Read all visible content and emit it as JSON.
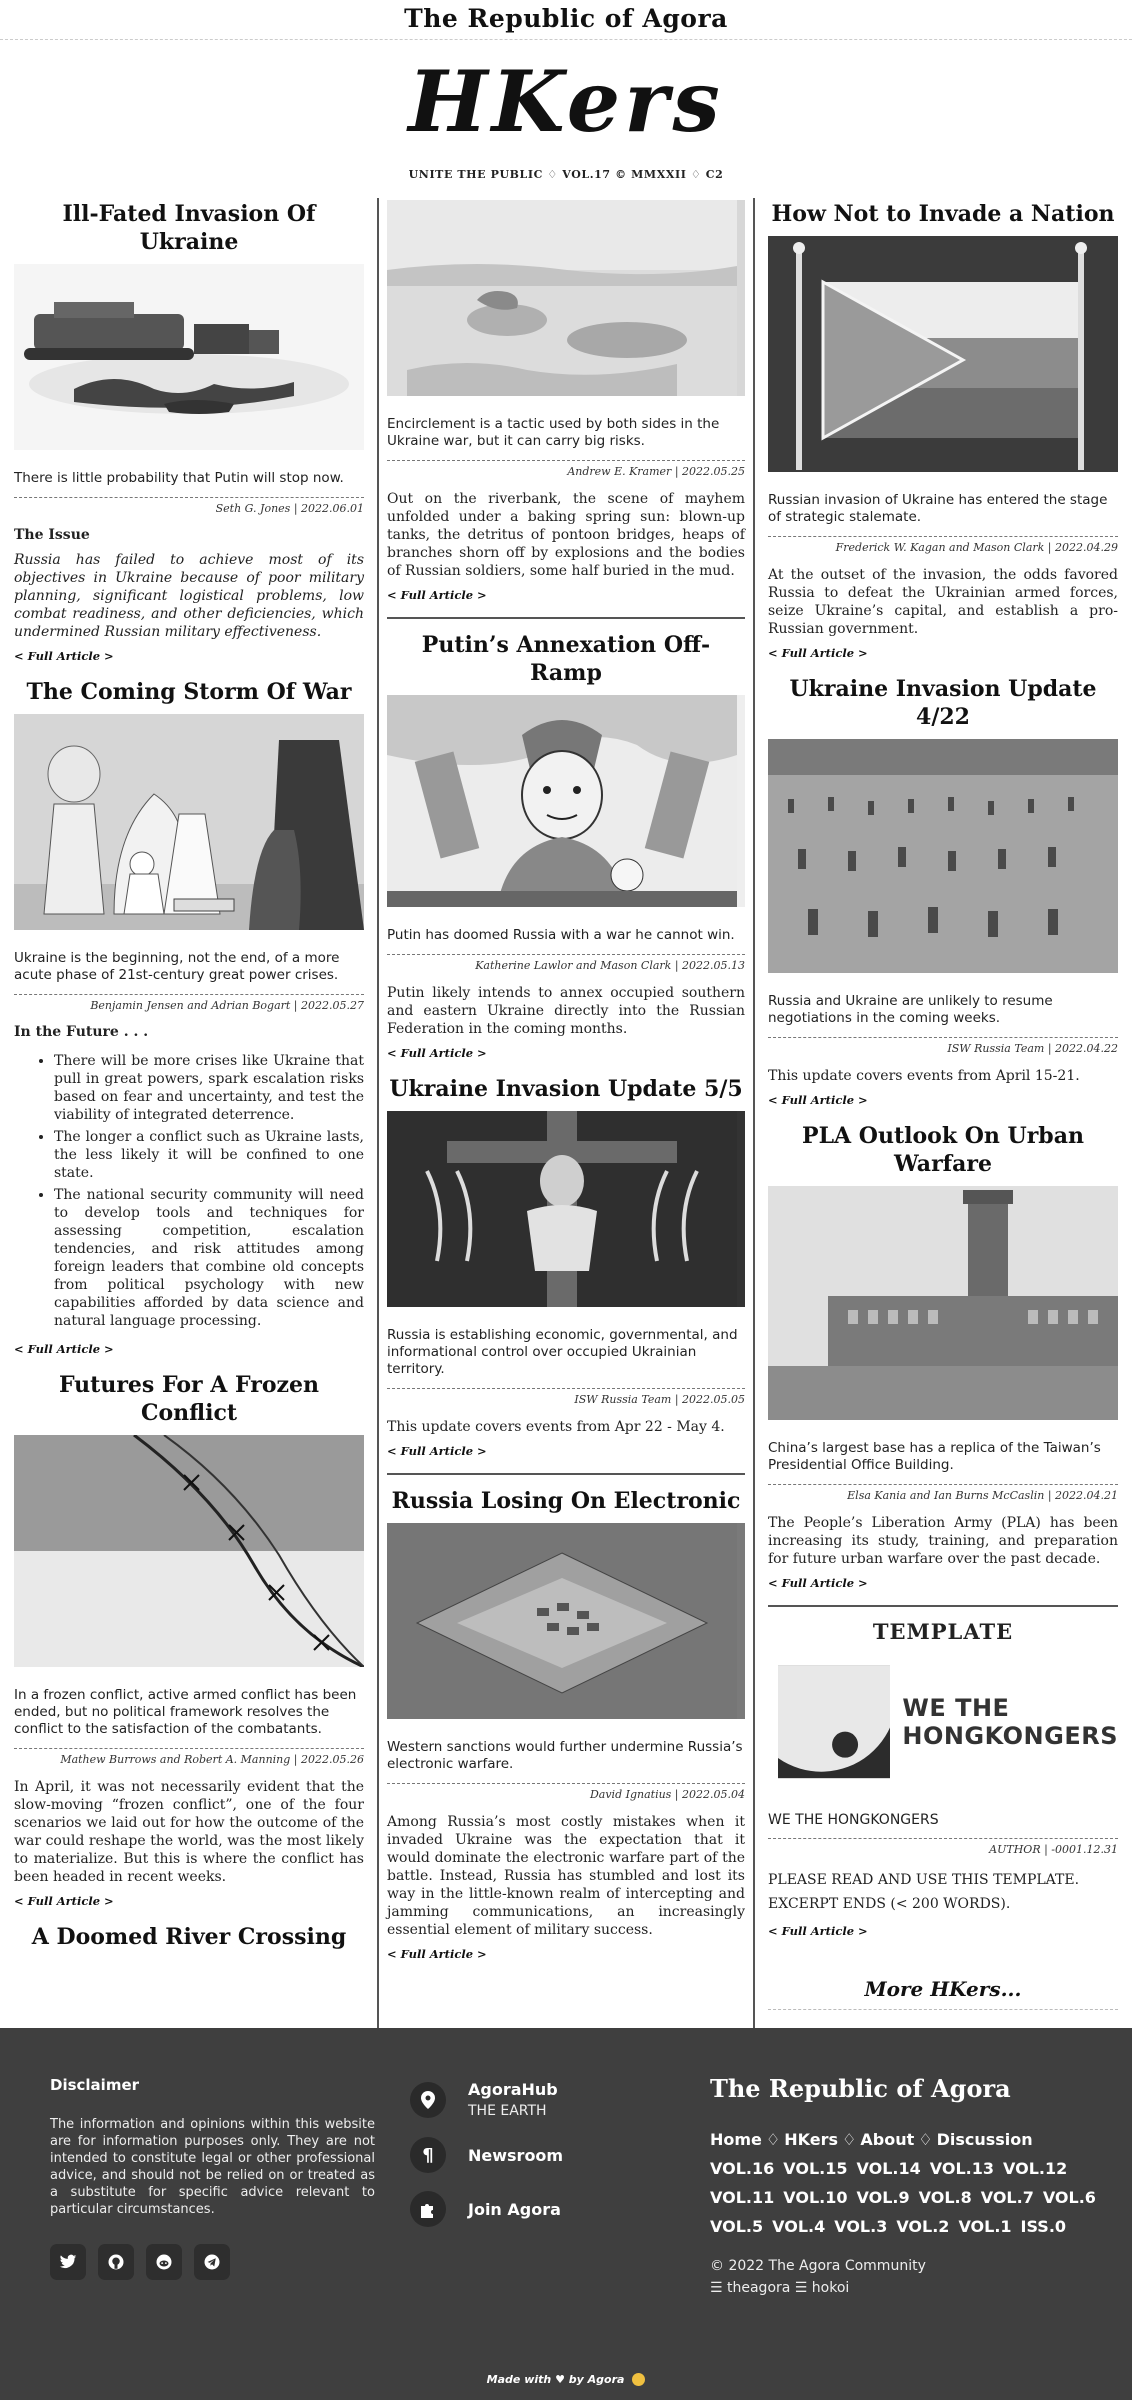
{
  "site": {
    "title": "The Republic of Agora",
    "logo": "HKers",
    "tagline": "UNITE THE PUBLIC ♢ VOL.17 © MMXXII ♢ C2"
  },
  "left": {
    "a1": {
      "title": "Ill-Fated Invasion Of Ukraine",
      "desc": "There is little probability that Putin will stop now.",
      "byline": "Seth G. Jones | 2022.06.01",
      "sub": "The Issue",
      "body": "Russia has failed to achieve most of its objectives in Ukraine because of poor military planning, significant logistical problems, low combat readiness, and other deficiencies, which undermined Russian military effectiveness.",
      "link": "< Full Article >"
    },
    "a2": {
      "title": "The Coming Storm Of War",
      "desc": "Ukraine is the beginning, not the end, of a more acute phase of 21st-century great power crises.",
      "byline": "Benjamin Jensen and Adrian Bogart | 2022.05.27",
      "sub": "In the Future . . .",
      "points": [
        "There will be more crises like Ukraine that pull in great powers, spark escalation risks based on fear and uncertainty, and test the viability of integrated deterrence.",
        "The longer a conflict such as Ukraine lasts, the less likely it will be confined to one state.",
        "The national security community will need to develop tools and techniques for assessing competition, escalation tendencies, and risk attitudes among foreign leaders that combine old concepts from political psychology with new capabilities afforded by data science and natural language processing."
      ],
      "link": "< Full Article >"
    },
    "a3": {
      "title": "Futures For A Frozen Conflict",
      "desc": "In a frozen conflict, active armed conflict has been ended, but no political framework resolves the conflict to the satisfaction of the combatants.",
      "byline": "Mathew Burrows and Robert A. Manning | 2022.05.26",
      "body": "In April, it was not necessarily evident that the slow-moving “frozen conflict”, one of the four scenarios we laid out for how the outcome of the war could reshape the world, was the most likely to materialize. But this is where the conflict has been headed in recent weeks.",
      "link": "< Full Article >"
    },
    "a4": {
      "title": "A Doomed River Crossing"
    }
  },
  "mid": {
    "a1": {
      "desc": "Encirclement is a tactic used by both sides in the Ukraine war, but it can carry big risks.",
      "byline": "Andrew E. Kramer | 2022.05.25",
      "body": "Out on the riverbank, the scene of mayhem unfolded under a baking spring sun: blown-up tanks, the detritus of pontoon bridges, heaps of branches shorn off by explosions and the bodies of Russian soldiers, some half buried in the mud.",
      "link": "< Full Article >"
    },
    "a2": {
      "title": "Putin’s Annexation Off-Ramp",
      "desc": "Putin has doomed Russia with a war he cannot win.",
      "byline": "Katherine Lawlor and Mason Clark | 2022.05.13",
      "body": "Putin likely intends to annex occupied southern and eastern Ukraine directly into the Russian Federation in the coming months.",
      "link": "< Full Article >"
    },
    "a3": {
      "title": "Ukraine Invasion Update 5/5",
      "desc": "Russia is establishing economic, governmental, and informational control over occupied Ukrainian territory.",
      "byline": "ISW Russia Team | 2022.05.05",
      "body": "This update covers events from Apr 22 - May 4.",
      "link": "< Full Article >"
    },
    "a4": {
      "title": "Russia Losing On Electronic",
      "desc": "Western sanctions would further undermine Russia’s electronic warfare.",
      "byline": "David Ignatius | 2022.05.04",
      "body": "Among Russia’s most costly mistakes when it invaded Ukraine was the expectation that it would dominate the electronic warfare part of the battle. Instead, Russia has stumbled and lost its way in the little-known realm of intercepting and jamming communications, an increasingly essential element of military success.",
      "link": "< Full Article >"
    }
  },
  "right": {
    "a1": {
      "title": "How Not to Invade a Nation",
      "desc": "Russian invasion of Ukraine has entered the stage of strategic stalemate.",
      "byline": "Frederick W. Kagan and Mason Clark | 2022.04.29",
      "body": "At the outset of the invasion, the odds favored Russia to defeat the Ukrainian armed forces, seize Ukraine’s capital, and establish a pro-Russian government.",
      "link": "< Full Article >"
    },
    "a2": {
      "title": "Ukraine Invasion Update 4/22",
      "desc": "Russia and Ukraine are unlikely to resume negotiations in the coming weeks.",
      "byline": "ISW Russia Team | 2022.04.22",
      "body": "This update covers events from April 15-21.",
      "link": "< Full Article >"
    },
    "a3": {
      "title": "PLA Outlook On Urban Warfare",
      "desc": "China’s largest base has a replica of the Taiwan’s Presidential Office Building.",
      "byline": "Elsa Kania and Ian Burns McCaslin | 2022.04.21",
      "body": "The People’s Liberation Army (PLA) has been increasing its study, training, and preparation for future urban warfare over the past decade.",
      "link": "< Full Article >"
    },
    "tpl": {
      "title": "TEMPLATE",
      "logo_line1": "WE THE",
      "logo_line2": "HONGKONGERS",
      "name": "WE THE HONGKONGERS",
      "byline": "AUTHOR | -0001.12.31",
      "body1": "PLEASE READ AND USE THIS TEMPLATE.",
      "body2": "EXCERPT ENDS (< 200 WORDS).",
      "link": "< Full Article >"
    },
    "more": "More HKers..."
  },
  "footer": {
    "disclaimer_title": "Disclaimer",
    "disclaimer": "The information and opinions within this website are for information purposes only. They are not intended to constitute legal or other professional advice, and should not be relied on or treated as a substitute for specific advice relevant to particular circumstances.",
    "hub": "AgoraHub",
    "hub_sub": "THE EARTH",
    "newsroom": "Newsroom",
    "join": "Join Agora",
    "brand": "The Republic of Agora",
    "nav": [
      "Home",
      "HKers",
      "About",
      "Discussion"
    ],
    "vols": [
      "VOL.16",
      "VOL.15",
      "VOL.14",
      "VOL.13",
      "VOL.12",
      "VOL.11",
      "VOL.10",
      "VOL.9",
      "VOL.8",
      "VOL.7",
      "VOL.6",
      "VOL.5",
      "VOL.4",
      "VOL.3",
      "VOL.2",
      "VOL.1",
      "ISS.0"
    ],
    "copyright": "© 2022 The Agora Community",
    "members": "☰ theagora ☰ hokoi",
    "made": "Made with",
    "made_by": "by Agora"
  },
  "colors": {
    "footer_bg": "#3f3f3f",
    "rule": "#555555"
  }
}
